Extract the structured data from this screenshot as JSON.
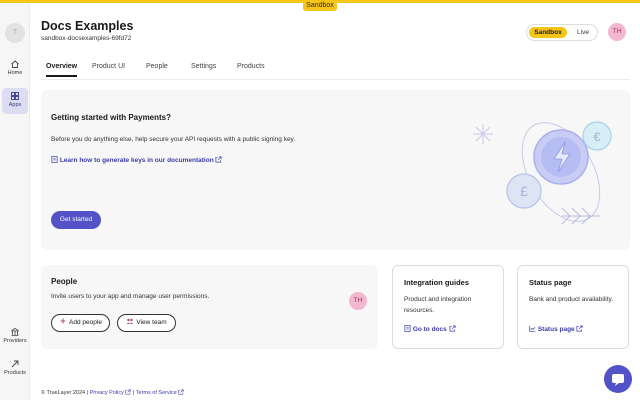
{
  "env_banner": "Sandbox",
  "sidebar": {
    "logo": "T",
    "items": [
      {
        "label": "Home",
        "icon": "home-icon"
      },
      {
        "label": "Apps",
        "icon": "apps-icon"
      },
      {
        "label": "Providers",
        "icon": "providers-icon"
      },
      {
        "label": "Products",
        "icon": "products-icon"
      }
    ]
  },
  "header": {
    "title": "Docs Examples",
    "subtitle": "sandbox-docsexamples-69fd72",
    "env_toggle": {
      "sandbox": "Sandbox",
      "live": "Live",
      "selected": "Sandbox"
    },
    "avatar": "TH"
  },
  "tabs": [
    {
      "label": "Overview",
      "active": true
    },
    {
      "label": "Product UI",
      "active": false
    },
    {
      "label": "People",
      "active": false
    },
    {
      "label": "Settings",
      "active": false
    },
    {
      "label": "Products",
      "active": false
    }
  ],
  "getting_started": {
    "title": "Getting started with Payments?",
    "description": "Before you do anything else, help secure your API requests with a public signing key.",
    "link": "Learn how to generate keys in our documentation",
    "button": "Get started"
  },
  "people": {
    "title": "People",
    "description": "Invite users to your app and manage user permissions.",
    "avatar": "TH",
    "add_button": "Add people",
    "view_button": "View team"
  },
  "integration_guides": {
    "title": "Integration guides",
    "description": "Product and integration resources.",
    "link": "Go to docs"
  },
  "status_page": {
    "title": "Status page",
    "description": "Bank and product availability.",
    "link": "Status page"
  },
  "footer": {
    "copyright": "© TrueLayer 2024 |",
    "privacy": "Privacy Policy",
    "separator": "|",
    "terms": "Terms of Service"
  },
  "colors": {
    "accent": "#5353c7",
    "sandbox_yellow": "#f5c518",
    "avatar_pink": "#f3b8cf"
  }
}
